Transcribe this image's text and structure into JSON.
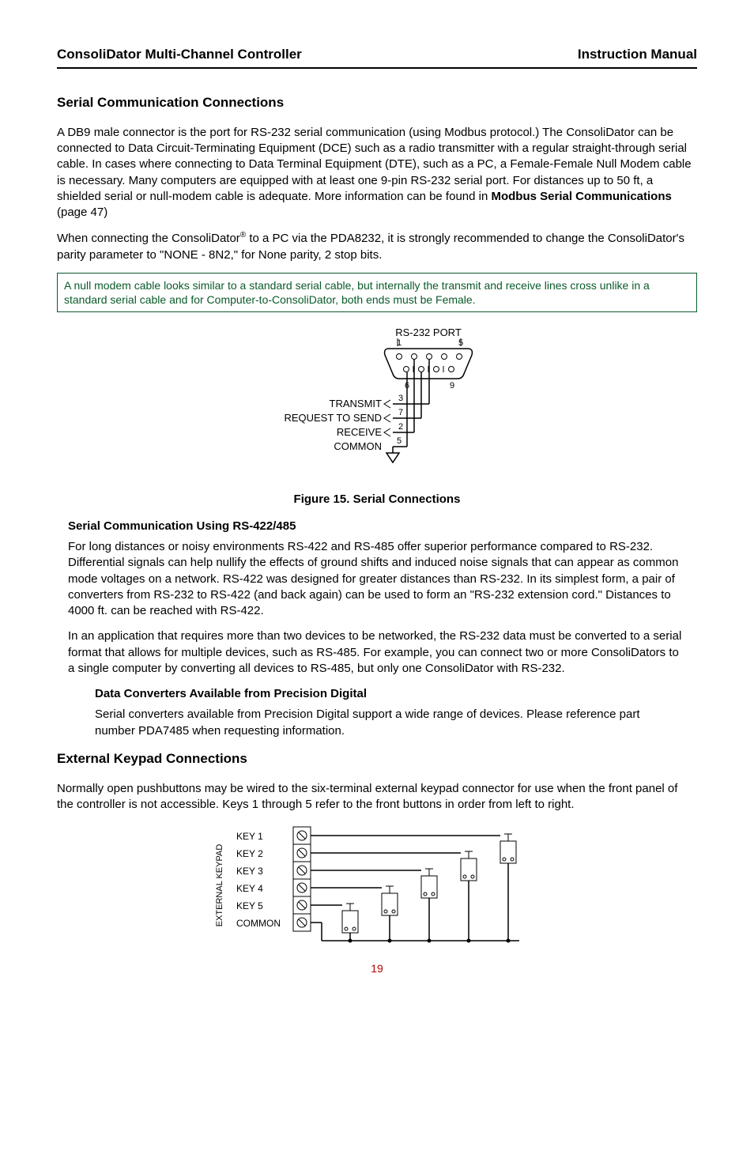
{
  "header": {
    "left": "ConsoliDator Multi-Channel Controller",
    "right": "Instruction Manual"
  },
  "sec1": {
    "title": "Serial Communication Connections",
    "p1": "A DB9 male connector is the port for RS-232 serial communication (using Modbus protocol.) The ConsoliDator can be connected to Data Circuit-Terminating Equipment (DCE) such as a radio transmitter with a regular straight-through serial cable. In cases where connecting to Data Terminal Equipment (DTE), such as a PC, a Female-Female Null Modem cable is necessary. Many computers are equipped with at least one 9-pin RS-232 serial port. For distances up to 50 ft, a shielded serial or null-modem cable is adequate. More information can be found in ",
    "p1_bold": "Modbus Serial Communications",
    "p1_tail": " (page 47)",
    "p2_a": "When connecting the ConsoliDator",
    "p2_b": " to a PC via the PDA8232, it is strongly recommended to change the ConsoliDator's parity parameter to \"NONE - 8N2,\" for None parity, 2 stop bits.",
    "note": "A null modem cable looks similar to a standard serial cable, but internally the transmit and receive lines cross unlike in a standard serial cable and for Computer-to-ConsoliDator, both ends must be Female."
  },
  "fig1": {
    "caption": "Figure 15. Serial Connections",
    "port_label": "RS-232 PORT",
    "pin1": "1",
    "pin5": "5",
    "pin6": "6",
    "pin9": "9",
    "transmit": "TRANSMIT",
    "rts": "REQUEST TO SEND",
    "receive": "RECEIVE",
    "common": "COMMON",
    "wire3": "3",
    "wire7": "7",
    "wire2": "2",
    "wire5": "5"
  },
  "sub1": {
    "title": "Serial Communication Using RS-422/485",
    "p1": "For long distances or noisy environments RS-422 and RS-485 offer superior performance compared to RS-232. Differential signals can help nullify the effects of ground shifts and induced noise signals that can appear as common mode voltages on a network. RS-422 was designed for greater distances than RS-232. In its simplest form, a pair of converters from RS-232 to RS-422 (and back again) can be used to form an \"RS-232 extension cord.\" Distances to 4000 ft. can be reached with RS-422.",
    "p2": "In an application that requires more than two devices to be networked, the RS-232 data must be converted to a serial format that allows for multiple devices, such as RS-485. For example, you can connect two or more ConsoliDators to a single computer by converting all devices to RS-485, but only one ConsoliDator with RS-232.",
    "sub_title": "Data Converters Available from Precision Digital",
    "p3": "Serial converters available from Precision Digital support a wide range of devices. Please reference part number PDA7485 when requesting information."
  },
  "sec2": {
    "title": "External Keypad Connections",
    "p1": "Normally open pushbuttons may be wired to the six-terminal external keypad connector for use when the front panel of the controller is not accessible. Keys 1 through 5 refer to the front buttons in order from left to right."
  },
  "fig2": {
    "vert_label": "EXTERNAL KEYPAD",
    "k1": "KEY 1",
    "k2": "KEY 2",
    "k3": "KEY 3",
    "k4": "KEY 4",
    "k5": "KEY 5",
    "common": "COMMON"
  },
  "page_num": "19"
}
